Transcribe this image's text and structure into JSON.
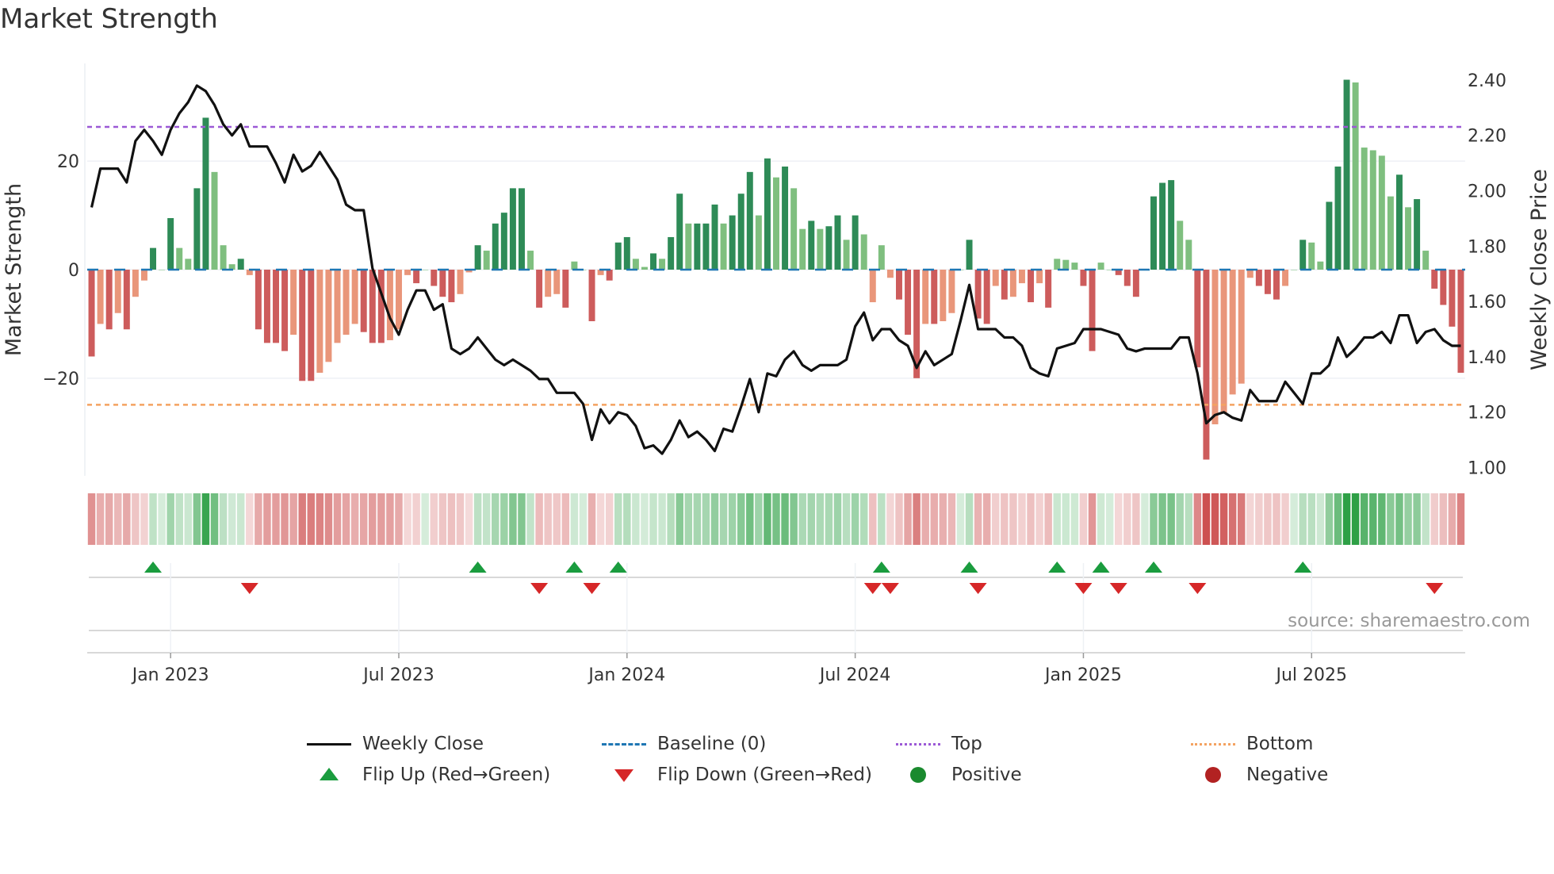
{
  "title": "Market Strength",
  "source": "source: sharemaestro.com",
  "colors": {
    "pos_strong": "#2e8b57",
    "pos_weak": "#7fbf7f",
    "neg_strong": "#cd5c5c",
    "neg_weak": "#e9967a",
    "baseline": "#1f77b4",
    "top": "#9b59d6",
    "bottom": "#f4a261",
    "close": "#111111",
    "flip_up": "#1a9c3e",
    "flip_down": "#d62728",
    "positive": "#1a8a2e",
    "negative": "#b22222"
  },
  "chart_data": {
    "type": "bar+line",
    "title": "Market Strength",
    "ylabel": "Market Strength",
    "y2label": "Weekly Close Price",
    "ylim": [
      -38,
      38
    ],
    "y2lim": [
      0.97,
      2.46
    ],
    "yticks": [
      {
        "v": 20,
        "label": "20"
      },
      {
        "v": 0,
        "label": "0"
      },
      {
        "v": -20,
        "label": "−20"
      }
    ],
    "y2ticks": [
      {
        "v": 2.4,
        "label": "2.40"
      },
      {
        "v": 2.2,
        "label": "2.20"
      },
      {
        "v": 2.0,
        "label": "2.00"
      },
      {
        "v": 1.8,
        "label": "1.80"
      },
      {
        "v": 1.6,
        "label": "1.60"
      },
      {
        "v": 1.4,
        "label": "1.40"
      },
      {
        "v": 1.2,
        "label": "1.20"
      },
      {
        "v": 1.0,
        "label": "1.00"
      }
    ],
    "xticks": [
      {
        "week": 9,
        "label": "Jan 2023"
      },
      {
        "week": 35,
        "label": "Jul 2023"
      },
      {
        "week": 61,
        "label": "Jan 2024"
      },
      {
        "week": 87,
        "label": "Jul 2024"
      },
      {
        "week": 113,
        "label": "Jan 2025"
      },
      {
        "week": 139,
        "label": "Jul 2025"
      }
    ],
    "top_level": 26.3,
    "bottom_level": -24.9,
    "strength": [
      -16,
      -10,
      -11,
      -8,
      -11,
      -5,
      -2,
      4,
      0,
      9.5,
      4,
      2,
      15,
      28,
      18,
      4.5,
      1,
      2,
      -1,
      -11,
      -13.5,
      -13.5,
      -15,
      -12,
      -20.5,
      -20.5,
      -19,
      -17,
      -13.5,
      -12,
      -10,
      -11.5,
      -13.5,
      -13.5,
      -13,
      -11,
      -1,
      -2.5,
      0,
      -3,
      -5,
      -6,
      -4.5,
      -0.5,
      4.5,
      3.5,
      8.5,
      10.5,
      15,
      15,
      3.5,
      -7,
      -5,
      -4.5,
      -7,
      1.5,
      0,
      -9.5,
      -1,
      -2,
      5,
      6,
      2,
      0.5,
      3,
      2,
      6,
      14,
      8.5,
      8.5,
      8.5,
      12,
      8.5,
      10,
      14,
      18,
      10,
      20.5,
      17,
      19,
      15,
      7.5,
      9,
      7.5,
      8,
      10,
      5.5,
      10,
      6.5,
      -6,
      4.5,
      -1.5,
      -5.5,
      -12,
      -20,
      -10,
      -10,
      -9.5,
      -8,
      0,
      5.5,
      -9,
      -10,
      -3,
      -5.5,
      -5,
      -2.5,
      -6,
      -2.5,
      -7,
      2,
      1.8,
      1.3,
      -3,
      -15,
      1.3,
      0,
      -1,
      -3,
      -5,
      0,
      13.5,
      16,
      16.5,
      9,
      5.5,
      -18,
      -35,
      -28.5,
      -26.5,
      -23,
      -21,
      -1.5,
      -3,
      -4.5,
      -5.5,
      -3,
      0,
      5.5,
      5,
      1.5,
      12.5,
      19,
      35,
      34.5,
      22.5,
      22,
      21,
      13.5,
      17.5,
      11.5,
      13,
      3.5,
      -3.5,
      -6.5,
      -10.5,
      -19
    ],
    "close": [
      1.94,
      2.08,
      2.08,
      2.08,
      2.03,
      2.18,
      2.22,
      2.18,
      2.13,
      2.22,
      2.28,
      2.32,
      2.38,
      2.36,
      2.31,
      2.24,
      2.2,
      2.24,
      2.16,
      2.16,
      2.16,
      2.1,
      2.03,
      2.13,
      2.07,
      2.09,
      2.14,
      2.09,
      2.04,
      1.95,
      1.93,
      1.93,
      1.72,
      1.63,
      1.54,
      1.48,
      1.57,
      1.64,
      1.64,
      1.57,
      1.59,
      1.43,
      1.41,
      1.43,
      1.47,
      1.43,
      1.39,
      1.37,
      1.39,
      1.37,
      1.35,
      1.32,
      1.32,
      1.27,
      1.27,
      1.27,
      1.23,
      1.1,
      1.21,
      1.16,
      1.2,
      1.19,
      1.15,
      1.07,
      1.08,
      1.05,
      1.1,
      1.17,
      1.11,
      1.13,
      1.1,
      1.06,
      1.14,
      1.13,
      1.22,
      1.32,
      1.2,
      1.34,
      1.33,
      1.39,
      1.42,
      1.37,
      1.35,
      1.37,
      1.37,
      1.37,
      1.39,
      1.51,
      1.56,
      1.46,
      1.5,
      1.5,
      1.46,
      1.44,
      1.36,
      1.42,
      1.37,
      1.39,
      1.41,
      1.53,
      1.66,
      1.5,
      1.5,
      1.5,
      1.47,
      1.47,
      1.44,
      1.36,
      1.34,
      1.33,
      1.43,
      1.44,
      1.45,
      1.5,
      1.5,
      1.5,
      1.49,
      1.48,
      1.43,
      1.42,
      1.43,
      1.43,
      1.43,
      1.43,
      1.47,
      1.47,
      1.34,
      1.16,
      1.19,
      1.2,
      1.18,
      1.17,
      1.28,
      1.24,
      1.24,
      1.24,
      1.31,
      1.27,
      1.23,
      1.34,
      1.34,
      1.37,
      1.47,
      1.4,
      1.43,
      1.47,
      1.47,
      1.49,
      1.45,
      1.55,
      1.55,
      1.45,
      1.49,
      1.5,
      1.46,
      1.44,
      1.44
    ]
  },
  "legend": [
    {
      "label": "Weekly Close",
      "symbol": "solid-line",
      "color": "#111111"
    },
    {
      "label": "Baseline (0)",
      "symbol": "dashed-line",
      "color": "#1f77b4"
    },
    {
      "label": "Top",
      "symbol": "dotted-line",
      "color": "#9b59d6"
    },
    {
      "label": "Bottom",
      "symbol": "dotted-line",
      "color": "#f4a261"
    },
    {
      "label": "Flip Up (Red→Green)",
      "symbol": "triangle-up",
      "color": "#1a9c3e"
    },
    {
      "label": "Flip Down (Green→Red)",
      "symbol": "triangle-down",
      "color": "#d62728"
    },
    {
      "label": "Positive",
      "symbol": "circle",
      "color": "#1a8a2e"
    },
    {
      "label": "Negative",
      "symbol": "circle",
      "color": "#b22222"
    }
  ]
}
